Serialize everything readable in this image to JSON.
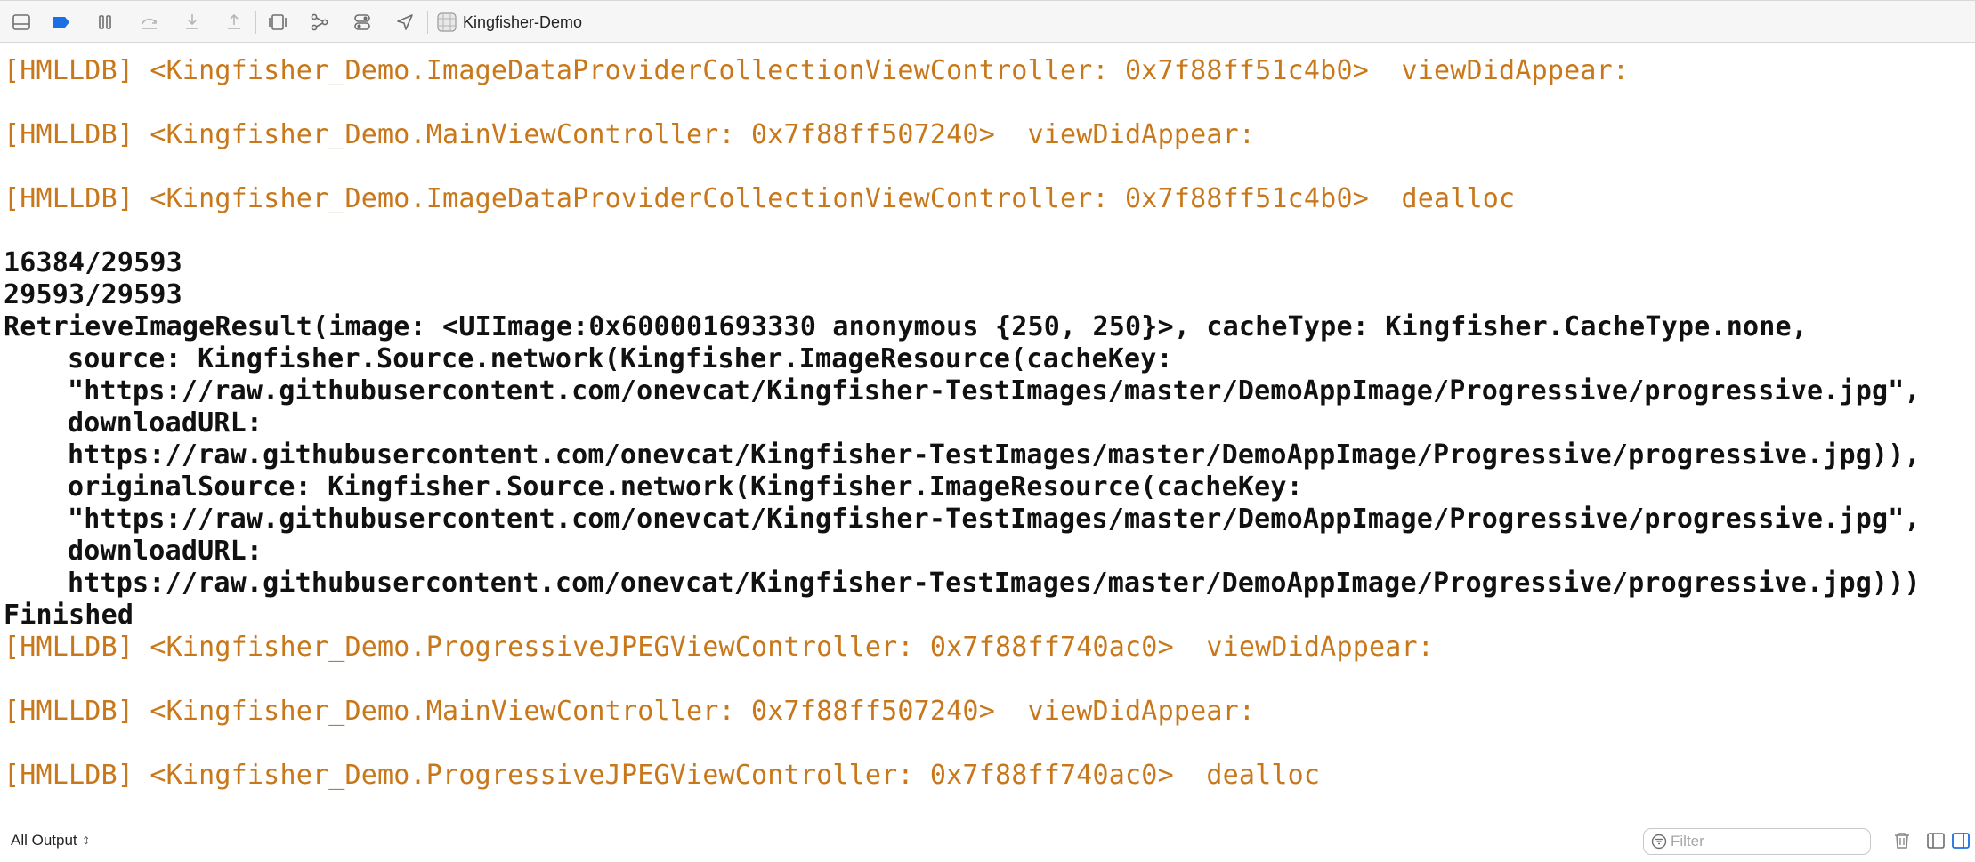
{
  "toolbar": {
    "icons": [
      "hide-debug-area-icon",
      "breakpoints-toggle-icon",
      "pause-icon",
      "step-over-icon",
      "step-into-icon",
      "step-out-icon",
      "debug-view-hierarchy-icon",
      "debug-memory-graph-icon",
      "environment-overrides-icon",
      "simulate-location-icon"
    ],
    "target_name": "Kingfisher-Demo",
    "accent_color": "#1a6fe5"
  },
  "console": {
    "log_color": "#c8781b",
    "output_color": "#111111",
    "lines": [
      {
        "text": "[HMLLDB] <Kingfisher_Demo.ImageDataProviderCollectionViewController: 0x7f88ff51c4b0>  viewDidAppear:"
      },
      {
        "text": "[HMLLDB] <Kingfisher_Demo.MainViewController: 0x7f88ff507240>  viewDidAppear:"
      },
      {
        "text": "[HMLLDB] <Kingfisher_Demo.ImageDataProviderCollectionViewController: 0x7f88ff51c4b0>  dealloc"
      },
      {
        "text": "16384/29593"
      },
      {
        "text": "29593/29593"
      },
      {
        "text": "RetrieveImageResult(image: <UIImage:0x600001693330 anonymous {250, 250}>, cacheType: Kingfisher.CacheType.none,"
      },
      {
        "text": "source: Kingfisher.Source.network(Kingfisher.ImageResource(cacheKey:"
      },
      {
        "text": "\"https://raw.githubusercontent.com/onevcat/Kingfisher-TestImages/master/DemoAppImage/Progressive/progressive.jpg\","
      },
      {
        "text": "downloadURL:"
      },
      {
        "text": "https://raw.githubusercontent.com/onevcat/Kingfisher-TestImages/master/DemoAppImage/Progressive/progressive.jpg)),"
      },
      {
        "text": "originalSource: Kingfisher.Source.network(Kingfisher.ImageResource(cacheKey:"
      },
      {
        "text": "\"https://raw.githubusercontent.com/onevcat/Kingfisher-TestImages/master/DemoAppImage/Progressive/progressive.jpg\","
      },
      {
        "text": "downloadURL:"
      },
      {
        "text": "https://raw.githubusercontent.com/onevcat/Kingfisher-TestImages/master/DemoAppImage/Progressive/progressive.jpg)))"
      },
      {
        "text": "Finished"
      },
      {
        "text": "[HMLLDB] <Kingfisher_Demo.ProgressiveJPEGViewController: 0x7f88ff740ac0>  viewDidAppear:"
      },
      {
        "text": "[HMLLDB] <Kingfisher_Demo.MainViewController: 0x7f88ff507240>  viewDidAppear:"
      },
      {
        "text": "[HMLLDB] <Kingfisher_Demo.ProgressiveJPEGViewController: 0x7f88ff740ac0>  dealloc"
      }
    ]
  },
  "bottom_bar": {
    "output_selector_label": "All Output",
    "filter_placeholder": "Filter",
    "filter_value": "",
    "icons": [
      "filter-icon",
      "trash-icon",
      "variables-view-icon",
      "console-view-icon"
    ],
    "active_color": "#1a6fe5"
  }
}
